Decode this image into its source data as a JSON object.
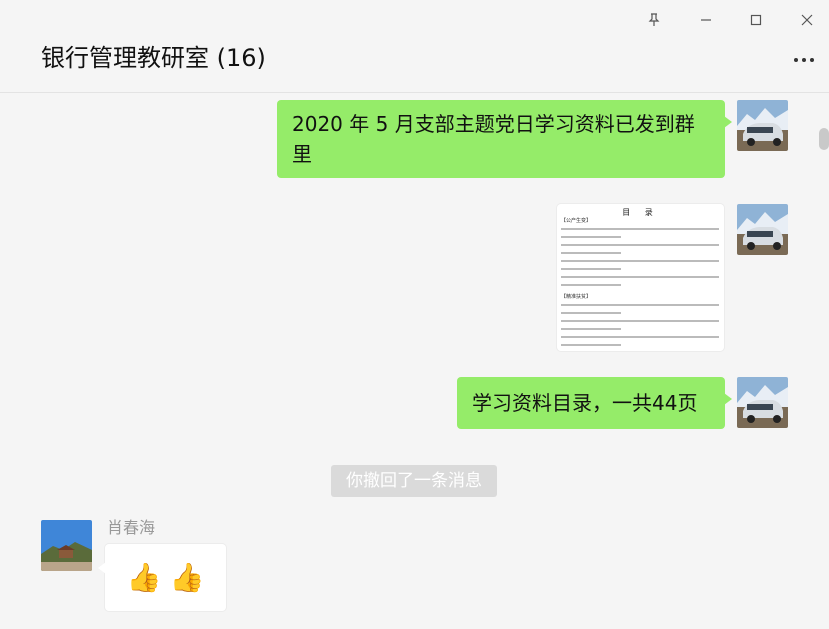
{
  "window": {
    "title": "银行管理教研室 (16)",
    "controls": [
      "pin-icon",
      "minimize-icon",
      "maximize-icon",
      "close-icon"
    ],
    "more_icon": "more-icon"
  },
  "messages": [
    {
      "type": "text",
      "from": "self",
      "text": "2020 年 5 月支部主题党日学习资料已发到群里"
    },
    {
      "type": "image",
      "from": "self",
      "image": {
        "title": "目 录",
        "sections": [
          "【公产生变】",
          "【精准扶贫】"
        ]
      }
    },
    {
      "type": "text",
      "from": "self",
      "text": "学习资料目录，一共44页"
    },
    {
      "type": "system",
      "text": "你撤回了一条消息"
    },
    {
      "type": "emoji",
      "from": "other",
      "sender": "肖春海",
      "emoji": [
        "👍",
        "👍"
      ]
    }
  ],
  "colors": {
    "self_bubble": "#95ec69",
    "background": "#f5f5f5",
    "other_bubble": "#ffffff"
  }
}
